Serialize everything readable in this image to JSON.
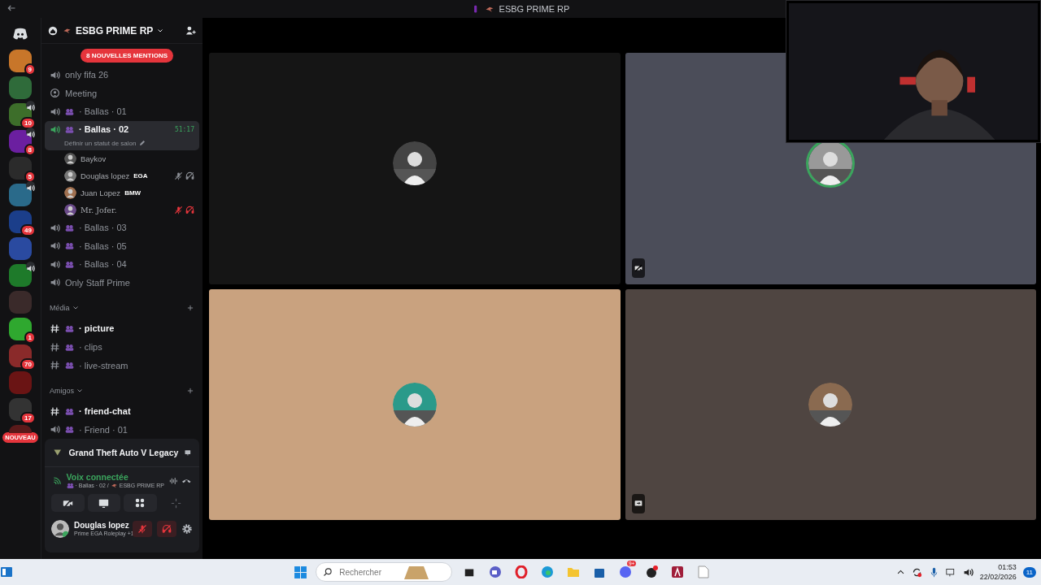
{
  "title_bar": {
    "title": "ESBG PRIME RP"
  },
  "servers": [
    {
      "badge": "9",
      "voice": false,
      "color": "#c8762a"
    },
    {
      "voice": false,
      "color": "#2f6b3a"
    },
    {
      "badge": "10",
      "voice": true,
      "color": "#3d6e2a"
    },
    {
      "badge": "8",
      "voice": true,
      "color": "#6b1fa0"
    },
    {
      "badge": "5",
      "voice": false,
      "color": "#2b2b2b"
    },
    {
      "voice": true,
      "color": "#2a6a8a"
    },
    {
      "badge": "49",
      "voice": false,
      "color": "#1b3e8a"
    },
    {
      "voice": false,
      "color": "#2a4aa0"
    },
    {
      "voice": true,
      "color": "#1e7a2a"
    },
    {
      "voice": false,
      "color": "#3a2a2a"
    },
    {
      "badge": "1",
      "voice": false,
      "color": "#2fa82f"
    },
    {
      "badge": "70",
      "voice": false,
      "color": "#8a2a2a"
    },
    {
      "voice": false,
      "color": "#6a1414"
    },
    {
      "badge": "17",
      "voice": false,
      "color": "#333333"
    },
    {
      "badge": "NOUVEAU",
      "voice": false,
      "color": "#5a1a1a"
    }
  ],
  "guild": {
    "name": "ESBG PRIME RP",
    "mentions": "8 NOUVELLES MENTIONS"
  },
  "channels": [
    {
      "kind": "voice",
      "name": "only fifa 26",
      "unread": false,
      "selected": false
    },
    {
      "kind": "stage",
      "name": "Meeting",
      "unread": false,
      "selected": false
    },
    {
      "kind": "voice",
      "name": "· Ballas · 01",
      "unread": false,
      "selected": false
    },
    {
      "kind": "voice",
      "name": "· Ballas · 02",
      "unread": false,
      "selected": true,
      "timer": "51:17",
      "status": "Définir un statut de salon",
      "members": [
        {
          "name": "Baykov",
          "self_muted": false,
          "server_muted": false
        },
        {
          "name": "Douglas lopez",
          "tag": "EGA",
          "self_muted": true,
          "server_muted": false
        },
        {
          "name": "Juan Lopez",
          "tag": "BMW",
          "self_muted": false,
          "server_muted": false
        },
        {
          "name": "Mr. Jofer.",
          "self_muted": false,
          "server_muted": true
        }
      ]
    },
    {
      "kind": "voice",
      "name": "· Ballas · 03",
      "unread": false,
      "selected": false
    },
    {
      "kind": "voice",
      "name": "· Ballas · 05",
      "unread": false,
      "selected": false
    },
    {
      "kind": "voice",
      "name": "· Ballas · 04",
      "unread": false,
      "selected": false
    },
    {
      "kind": "voice",
      "name": "Only Staff Prime",
      "unread": false,
      "selected": false
    },
    {
      "kind": "category",
      "name": "Média"
    },
    {
      "kind": "text",
      "name": "· picture",
      "unread": true,
      "selected": false
    },
    {
      "kind": "text",
      "name": "· clips",
      "unread": false,
      "selected": false
    },
    {
      "kind": "text",
      "name": "· live-stream",
      "unread": false,
      "selected": false
    },
    {
      "kind": "category",
      "name": "Amigos"
    },
    {
      "kind": "text",
      "name": "· friend-chat",
      "unread": true,
      "selected": false
    },
    {
      "kind": "voice",
      "name": "· Friend · 01",
      "unread": false,
      "selected": false
    }
  ],
  "activity": {
    "game": "Grand Theft Auto V Legacy"
  },
  "voice_panel": {
    "status": "Voix connectée",
    "channel": "· Ballas · 02 / ",
    "server": "ESBG PRIME RP"
  },
  "user": {
    "name": "Douglas lopez",
    "status": "Prime EGA Roleplay +1"
  },
  "tiles": [
    {
      "color": "#151515",
      "speaking": false,
      "kind": "plain"
    },
    {
      "color": "#4b4d59",
      "speaking": true,
      "kind": "camera-off"
    },
    {
      "color": "#c9a27f",
      "speaking": false,
      "kind": "plain"
    },
    {
      "color": "#4f4541",
      "speaking": false,
      "kind": "stream"
    }
  ],
  "taskbar": {
    "search_placeholder": "Rechercher",
    "discord_badge": "9+",
    "time": "01:53",
    "date": "22/02/2026",
    "notifications": "11"
  }
}
